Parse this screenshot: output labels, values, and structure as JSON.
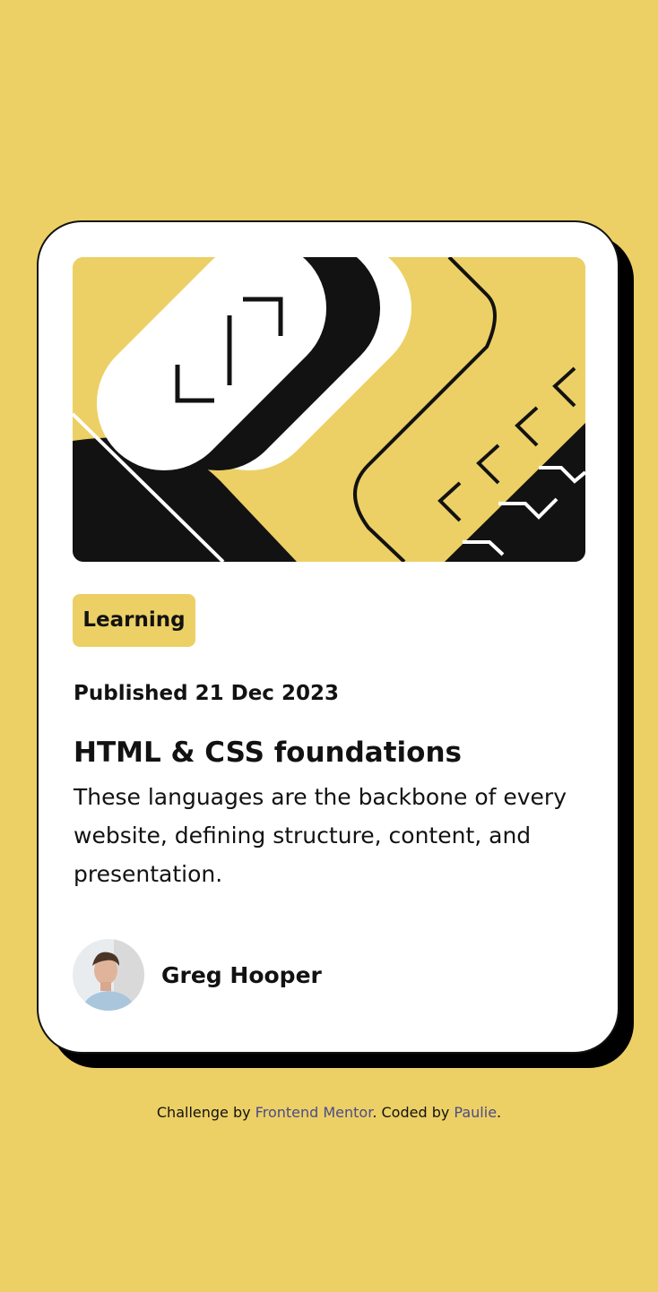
{
  "card": {
    "tag": "Learning",
    "published": "Published 21 Dec 2023",
    "title": "HTML & CSS foundations",
    "description": "These languages are the backbone of every website, defining structure, content, and presentation.",
    "author": {
      "name": "Greg Hooper",
      "avatar": "avatar-photo"
    },
    "hero_image": "illustration-article"
  },
  "attribution": {
    "prefix": "Challenge by ",
    "link1": "Frontend Mentor",
    "middle": ". Coded by ",
    "link2": "Paulie",
    "suffix": "."
  },
  "colors": {
    "background": "#ecd065",
    "card": "#ffffff",
    "text": "#121212",
    "shadow": "#000000",
    "link": "#4b4b88"
  }
}
